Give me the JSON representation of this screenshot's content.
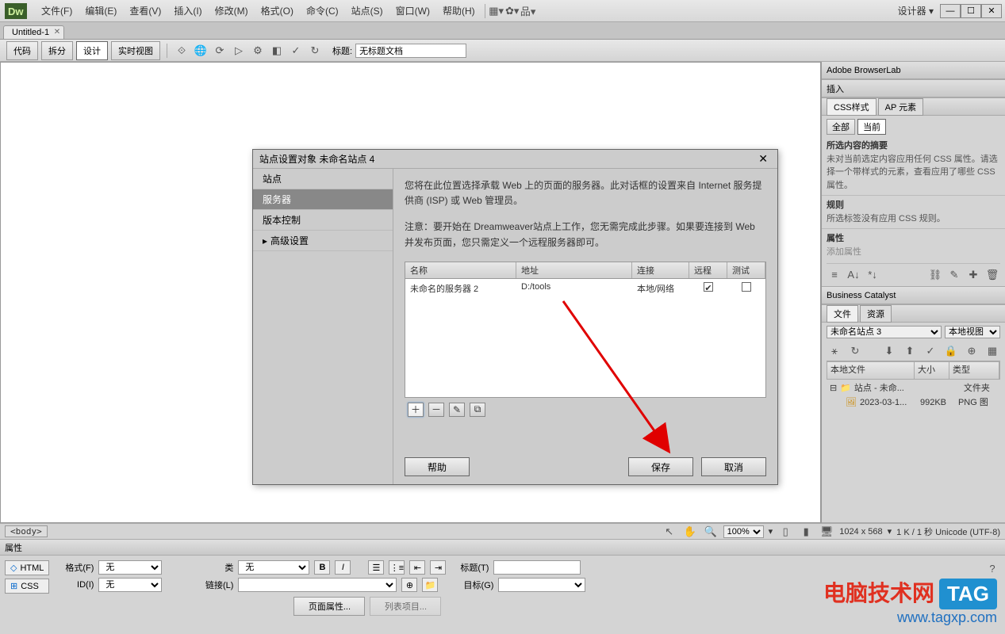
{
  "app": {
    "logo_text": "Dw",
    "designer_label": "设计器"
  },
  "menu": [
    "文件(F)",
    "编辑(E)",
    "查看(V)",
    "插入(I)",
    "修改(M)",
    "格式(O)",
    "命令(C)",
    "站点(S)",
    "窗口(W)",
    "帮助(H)"
  ],
  "doc_tab": {
    "name": "Untitled-1"
  },
  "toolbar": {
    "code": "代码",
    "split": "拆分",
    "design": "设计",
    "live": "实时视图",
    "title_label": "标题:",
    "title_value": "无标题文档"
  },
  "dialog": {
    "title": "站点设置对象 未命名站点 4",
    "nav": [
      "站点",
      "服务器",
      "版本控制",
      "高级设置"
    ],
    "nav_selected": 1,
    "desc1": "您将在此位置选择承载 Web 上的页面的服务器。此对话框的设置来自 Internet 服务提供商 (ISP) 或 Web 管理员。",
    "desc2": "注意：要开始在 Dreamweaver站点上工作，您无需完成此步骤。如果要连接到 Web 并发布页面，您只需定义一个远程服务器即可。",
    "columns": {
      "name": "名称",
      "address": "地址",
      "connection": "连接",
      "remote": "远程",
      "test": "测试"
    },
    "col_widths": {
      "name": 140,
      "address": 146,
      "connection": 72,
      "remote": 48,
      "test": 48
    },
    "row": {
      "name": "未命名的服务器 2",
      "address": "D:/tools",
      "connection": "本地/网络",
      "remote_checked": true,
      "test_checked": false
    },
    "btn_help": "帮助",
    "btn_save": "保存",
    "btn_cancel": "取消"
  },
  "side": {
    "browserlab": "Adobe BrowserLab",
    "insert": "插入",
    "css_tab": "CSS样式",
    "ap_tab": "AP 元素",
    "css_all": "全部",
    "css_current": "当前",
    "css_heading": "所选内容的摘要",
    "css_text": "未对当前选定内容应用任何 CSS 属性。请选择一个带样式的元素，查看应用了哪些 CSS 属性。",
    "rule_heading": "规则",
    "rule_text": "所选标签没有应用 CSS 规则。",
    "prop_heading": "属性",
    "prop_add": "添加属性",
    "bc": "Business Catalyst",
    "files_tab": "文件",
    "assets_tab": "资源",
    "site_select": "未命名站点 3",
    "view_select": "本地视图",
    "file_cols": {
      "local": "本地文件",
      "size": "大小",
      "type": "类型"
    },
    "file_root": "站点 - 未命...",
    "file_root_type": "文件夹",
    "file_item": "2023-03-1...",
    "file_item_size": "992KB",
    "file_item_type": "PNG 图"
  },
  "status": {
    "tag": "<body>",
    "zoom": "100%",
    "dims": "1024 x 568",
    "kb": "1 K / 1 秒 Unicode (UTF-8)"
  },
  "properties": {
    "header": "属性",
    "html_mode": "HTML",
    "css_mode": "CSS",
    "format_label": "格式(F)",
    "format_val": "无",
    "id_label": "ID(I)",
    "id_val": "无",
    "class_label": "类",
    "class_val": "无",
    "link_label": "链接(L)",
    "title_label": "标题(T)",
    "target_label": "目标(G)",
    "page_props": "页面属性...",
    "list_item": "列表项目..."
  },
  "watermark": {
    "line1": "电脑技术网",
    "line2": "www.tagxp.com",
    "tag": "TAG"
  }
}
